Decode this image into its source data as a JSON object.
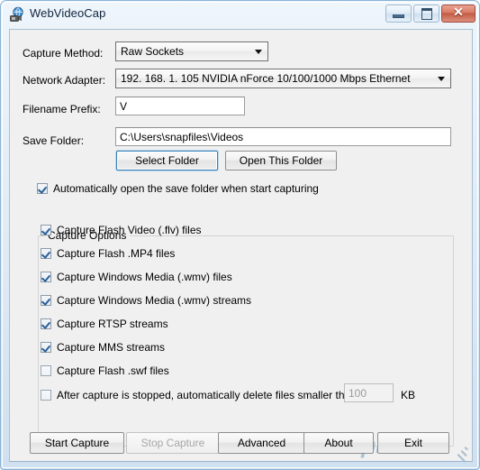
{
  "window": {
    "title": "WebVideoCap",
    "icon": "globe-camera-icon",
    "controls": {
      "minimize": "Minimize",
      "maximize": "Maximize",
      "close": "Close",
      "close_glyph": "✕"
    }
  },
  "form": {
    "capture_method": {
      "label": "Capture Method:",
      "value": "Raw Sockets"
    },
    "network_adapter": {
      "label": "Network Adapter:",
      "value": "192. 168. 1. 105   NVIDIA nForce 10/100/1000 Mbps Ethernet"
    },
    "filename_prefix": {
      "label": "Filename Prefix:",
      "value": "V"
    },
    "save_folder": {
      "label": "Save Folder:",
      "value": "C:\\Users\\snapfiles\\Videos"
    },
    "select_folder_button": "Select Folder",
    "open_folder_button": "Open This Folder",
    "auto_open": {
      "label": "Automatically open the save folder when start capturing",
      "checked": true
    }
  },
  "capture_options": {
    "group_label": "Capture Options",
    "items": [
      {
        "label": "Capture Flash Video (.flv) files",
        "checked": true
      },
      {
        "label": "Capture Flash .MP4 files",
        "checked": true
      },
      {
        "label": "Capture Windows Media (.wmv) files",
        "checked": true
      },
      {
        "label": "Capture Windows Media (.wmv) streams",
        "checked": true
      },
      {
        "label": "Capture RTSP streams",
        "checked": true
      },
      {
        "label": "Capture MMS streams",
        "checked": true
      },
      {
        "label": "Capture Flash .swf files",
        "checked": false
      }
    ],
    "delete_small": {
      "label": "After capture is stopped, automatically delete files smaller than:",
      "checked": false,
      "size_value": "100",
      "unit": "KB"
    }
  },
  "footer": {
    "buttons": [
      {
        "label": "Start Capture",
        "disabled": false
      },
      {
        "label": "Stop Capture",
        "disabled": true
      },
      {
        "label": "Advanced",
        "disabled": false
      },
      {
        "label": "About",
        "disabled": false
      },
      {
        "label": "Exit",
        "disabled": false
      }
    ]
  },
  "watermark": {
    "logo": "S",
    "text": "SnapFiles"
  }
}
